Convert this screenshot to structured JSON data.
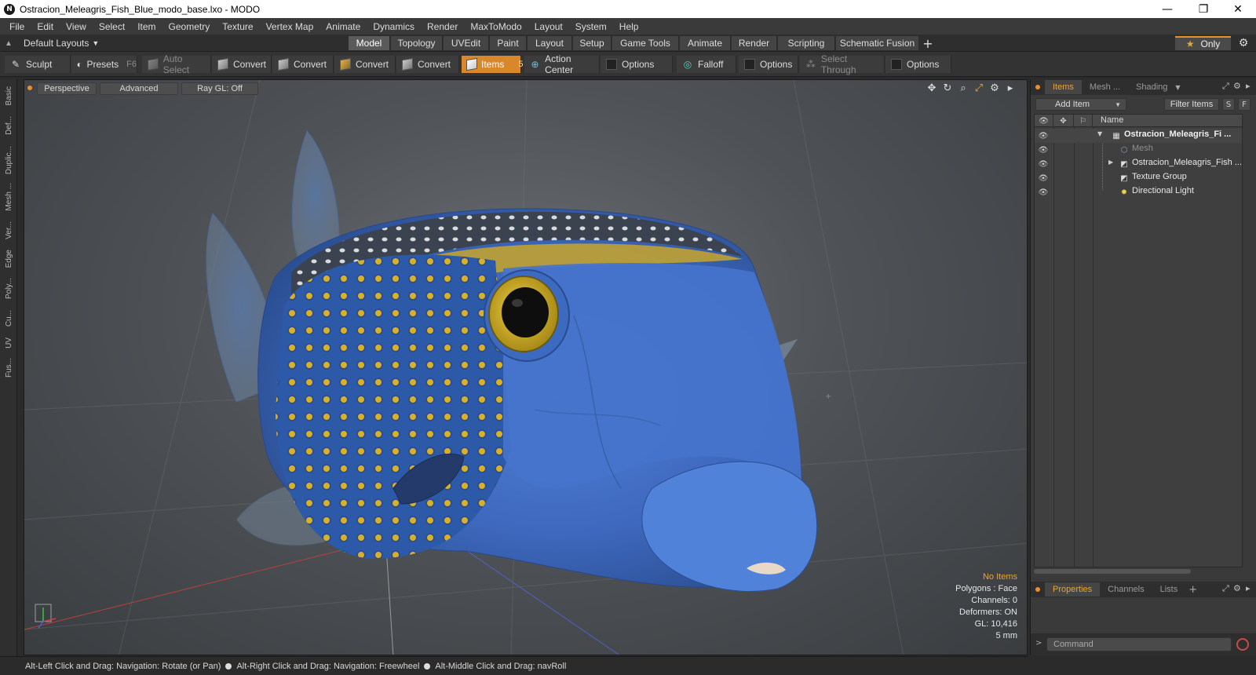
{
  "window": {
    "title": "Ostracion_Meleagris_Fish_Blue_modo_base.lxo - MODO",
    "app_icon": "N",
    "controls": [
      "—",
      "❐",
      "✕"
    ]
  },
  "menu": [
    "File",
    "Edit",
    "View",
    "Select",
    "Item",
    "Geometry",
    "Texture",
    "Vertex Map",
    "Animate",
    "Dynamics",
    "Render",
    "MaxToModo",
    "Layout",
    "System",
    "Help"
  ],
  "layouts": {
    "dropdown_label": "Default Layouts",
    "tabs": [
      "Model",
      "Topology",
      "UVEdit",
      "Paint",
      "Layout",
      "Setup",
      "Game Tools",
      "Animate",
      "Render",
      "Scripting",
      "Schematic Fusion"
    ],
    "active_tab": "Model",
    "only_label": "Only"
  },
  "toolbar": {
    "sculpt": "Sculpt",
    "presets": "Presets",
    "presets_key": "F6",
    "auto_select": "Auto Select",
    "convert_1": "Convert",
    "convert_2": "Convert",
    "convert_3": "Convert",
    "convert_4": "Convert",
    "items": "Items",
    "items_key": "5",
    "action_center": "Action Center",
    "options_1": "Options",
    "falloff": "Falloff",
    "options_2": "Options",
    "select_through": "Select Through",
    "options_3": "Options"
  },
  "left_tabs": [
    "Basic",
    "Def...",
    "Duplic...",
    "Mesh ...",
    "Ver...",
    "Edge",
    "Poly...",
    "Cu...",
    "UV",
    "Fus..."
  ],
  "viewport": {
    "view_mode": "Perspective",
    "shading": "Advanced",
    "raygl": "Ray GL: Off",
    "info": {
      "selection": "No Items",
      "polygons": "Polygons : Face",
      "channels": "Channels: 0",
      "deformers": "Deformers: ON",
      "gl": "GL: 10,416",
      "scale": "5 mm"
    }
  },
  "status": {
    "hint_1": "Alt-Left Click and Drag: Navigation: Rotate (or Pan)",
    "hint_2": "Alt-Right Click and Drag: Navigation: Freewheel",
    "hint_3": "Alt-Middle Click and Drag: navRoll"
  },
  "items_panel": {
    "tabs": [
      "Items",
      "Mesh ...",
      "Shading"
    ],
    "add_item": "Add Item",
    "filter_items": "Filter Items",
    "s_btn": "S",
    "f_btn": "F",
    "column_name": "Name",
    "rows": [
      {
        "label": "Ostracion_Meleagris_Fi ...",
        "icon": "scene-icon"
      },
      {
        "label": "Mesh",
        "icon": "mesh-icon"
      },
      {
        "label": "Ostracion_Meleagris_Fish ...",
        "icon": "group-icon"
      },
      {
        "label": "Texture Group",
        "icon": "texture-group-icon"
      },
      {
        "label": "Directional Light",
        "icon": "light-icon"
      }
    ]
  },
  "properties_panel": {
    "tabs": [
      "Properties",
      "Channels",
      "Lists"
    ],
    "command_placeholder": "Command"
  },
  "colors": {
    "accent": "#e8902a",
    "fish_blue": "#3f6fc9",
    "fish_spot": "#d8b02a"
  }
}
